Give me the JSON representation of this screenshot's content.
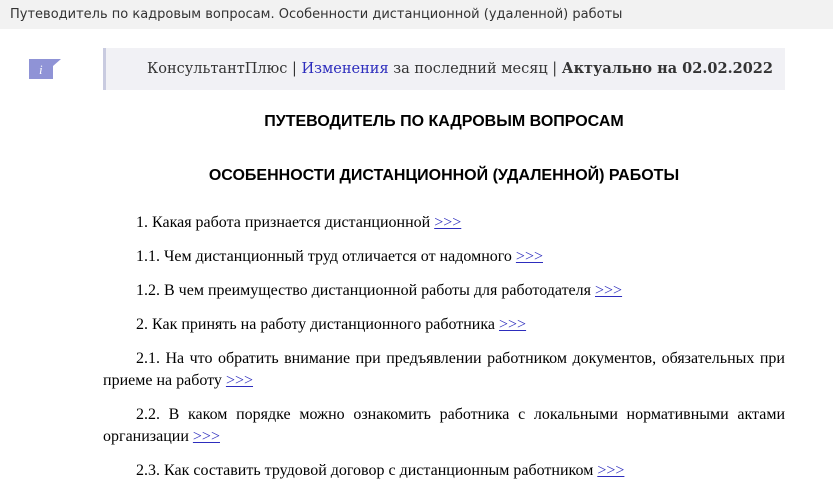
{
  "window": {
    "title": "Путеводитель по кадровым вопросам. Особенности дистанционной (удаленной) работы"
  },
  "info_icon": {
    "icon": "info-icon",
    "letter": "i",
    "color": "#8f93d6"
  },
  "header": {
    "brand": "КонсультантПлюс",
    "separator": "|",
    "changes_link": "Изменения",
    "changes_suffix": "за последний месяц",
    "actual": "Актуально на 02.02.2022"
  },
  "document": {
    "title": "ПУТЕВОДИТЕЛЬ ПО КАДРОВЫМ ВОПРОСАМ",
    "subtitle": "ОСОБЕННОСТИ ДИСТАНЦИОННОЙ (УДАЛЕННОЙ) РАБОТЫ",
    "link_label": ">>>",
    "items": [
      {
        "text": "1. Какая работа признается дистанционной"
      },
      {
        "text": "1.1. Чем дистанционный труд отличается от надомного"
      },
      {
        "text": "1.2. В чем преимущество дистанционной работы для работодателя"
      },
      {
        "text": "2. Как принять на работу дистанционного работника"
      },
      {
        "text": "2.1. На что обратить внимание при предъявлении работником документов, обязательных при приеме на работу"
      },
      {
        "text": "2.2. В каком порядке можно ознакомить работника с локальными нормативными актами организации"
      },
      {
        "text": "2.3. Как составить трудовой договор с дистанционным работником"
      }
    ]
  },
  "colors": {
    "link": "#2d2dbd",
    "header_bg": "#f1f1f5",
    "titlebar_bg": "#f2f2f2"
  }
}
